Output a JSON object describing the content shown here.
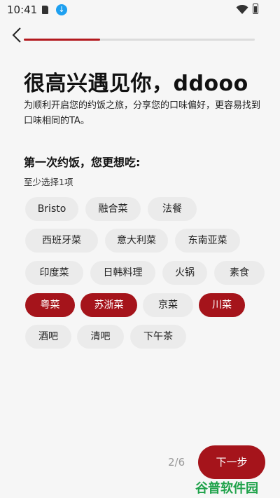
{
  "status_bar": {
    "time": "10:41",
    "icons": [
      "sd-card-icon",
      "download-icon",
      "wifi-icon",
      "battery-icon"
    ]
  },
  "progress": {
    "fraction": 0.33,
    "color": "#b3191e"
  },
  "header": {
    "title": "很高兴遇见你，ddooo",
    "intro": "为顺利开启您的约饭之旅，分享您的口味偏好，更容易找到口味相同的TA。"
  },
  "question": {
    "title": "第一次约饭，您更想吃:",
    "hint": "至少选择1项"
  },
  "tags": [
    {
      "label": "Bristo",
      "selected": false
    },
    {
      "label": "融合菜",
      "selected": false
    },
    {
      "label": "法餐",
      "selected": false
    },
    {
      "label": "西班牙菜",
      "selected": false
    },
    {
      "label": "意大利菜",
      "selected": false
    },
    {
      "label": "东南亚菜",
      "selected": false
    },
    {
      "label": "印度菜",
      "selected": false
    },
    {
      "label": "日韩料理",
      "selected": false
    },
    {
      "label": "火锅",
      "selected": false
    },
    {
      "label": "素食",
      "selected": false
    },
    {
      "label": "粤菜",
      "selected": true
    },
    {
      "label": "苏浙菜",
      "selected": true
    },
    {
      "label": "京菜",
      "selected": false
    },
    {
      "label": "川菜",
      "selected": true
    },
    {
      "label": "酒吧",
      "selected": false
    },
    {
      "label": "清吧",
      "selected": false
    },
    {
      "label": "下午茶",
      "selected": false
    }
  ],
  "footer": {
    "page_indicator": "2/6",
    "next_label": "下一步"
  },
  "watermark": "谷普软件园",
  "colors": {
    "accent": "#a5141b",
    "tag_bg": "#ebebeb",
    "background": "#f6f6f6"
  }
}
